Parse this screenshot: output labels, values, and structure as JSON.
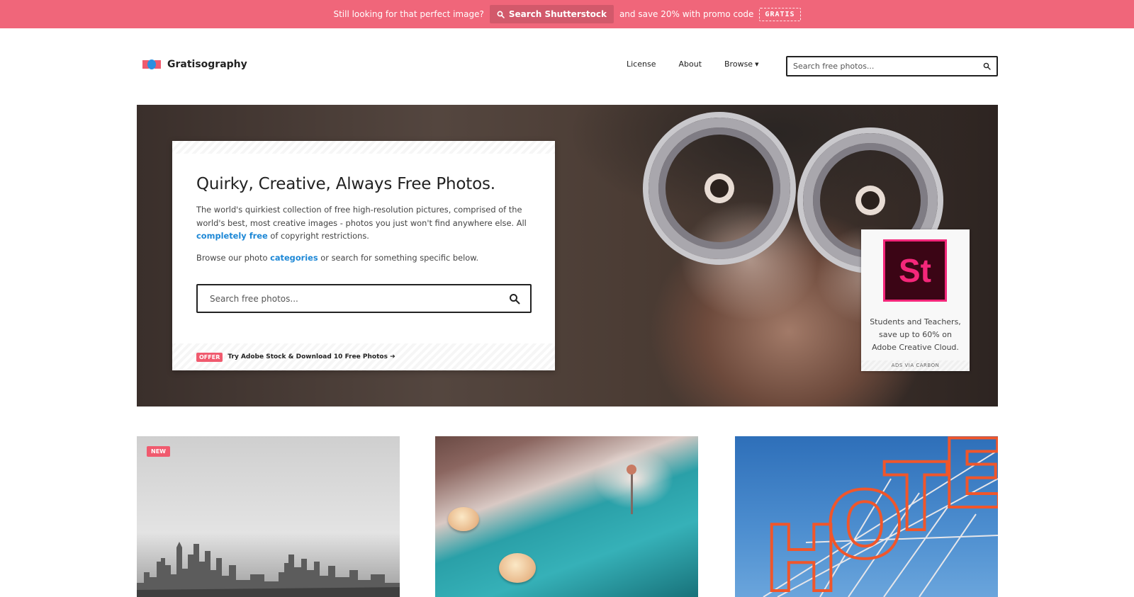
{
  "promo": {
    "lead": "Still looking for that perfect image?",
    "button": "Search Shutterstock",
    "tail": "and save 20% with promo code",
    "code": "GRATIS"
  },
  "brand": {
    "name": "Gratisography",
    "colors": {
      "accent": "#f05a6e",
      "link": "#1e88d6",
      "promo_bar": "#f0667a"
    }
  },
  "nav": {
    "items": [
      "License",
      "About",
      "Browse"
    ]
  },
  "header_search": {
    "placeholder": "Search free photos..."
  },
  "hero": {
    "title": "Quirky, Creative, Always Free Photos.",
    "desc_part1": "The world's quirkiest collection of free high-resolution pictures, comprised of the world's best, most creative images - photos you just won't find anywhere else. All ",
    "desc_link": "completely free",
    "desc_part2": " of copyright restrictions.",
    "browse_part1": "Browse our photo ",
    "browse_link": "categories",
    "browse_part2": " or search for something specific below.",
    "search_placeholder": "Search free photos...",
    "offer_badge": "OFFER",
    "offer_text": "Try Adobe Stock & Download 10 Free Photos"
  },
  "ad": {
    "logo_text": "St",
    "text": "Students and Teachers, save up to 60% on Adobe Creative Cloud.",
    "footer": "ADS VIA CARBON"
  },
  "grid": {
    "new_badge": "NEW",
    "hotel_letters": [
      "H",
      "O",
      "T",
      "E"
    ]
  }
}
